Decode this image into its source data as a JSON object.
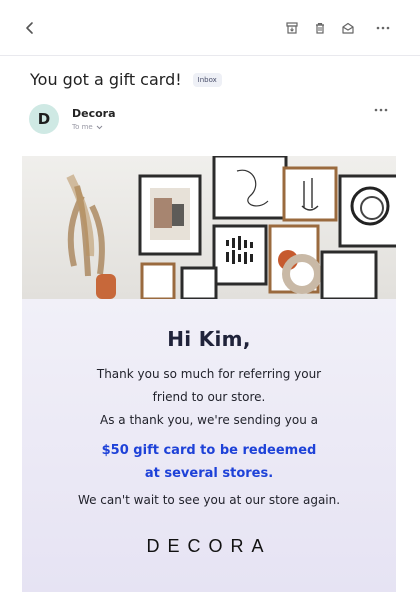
{
  "email": {
    "subject": "You got a gift card!",
    "badge": "Inbox",
    "sender": {
      "avatar_initial": "D",
      "name": "Decora",
      "to": "To me"
    }
  },
  "toolbar": {
    "icons": [
      "back-icon",
      "archive-icon",
      "trash-icon",
      "mail-open-icon",
      "more-icon"
    ]
  },
  "body": {
    "greeting": "Hi Kim,",
    "thanks_line1": "Thank you so much for referring your",
    "thanks_line2": "friend to our store.",
    "thanks_line3": "As a thank you, we're sending you a",
    "gift_line1": "$50 gift card to be redeemed",
    "gift_line2": "at several stores.",
    "closing": "We can't wait to see you at our store again.",
    "logo_text": "DECORA"
  },
  "colors": {
    "accent_blue": "#1e42d8",
    "avatar_bg": "#cfe9e4",
    "content_bg_top": "#f1f0f8",
    "content_bg_bottom": "#e6e3f3"
  }
}
